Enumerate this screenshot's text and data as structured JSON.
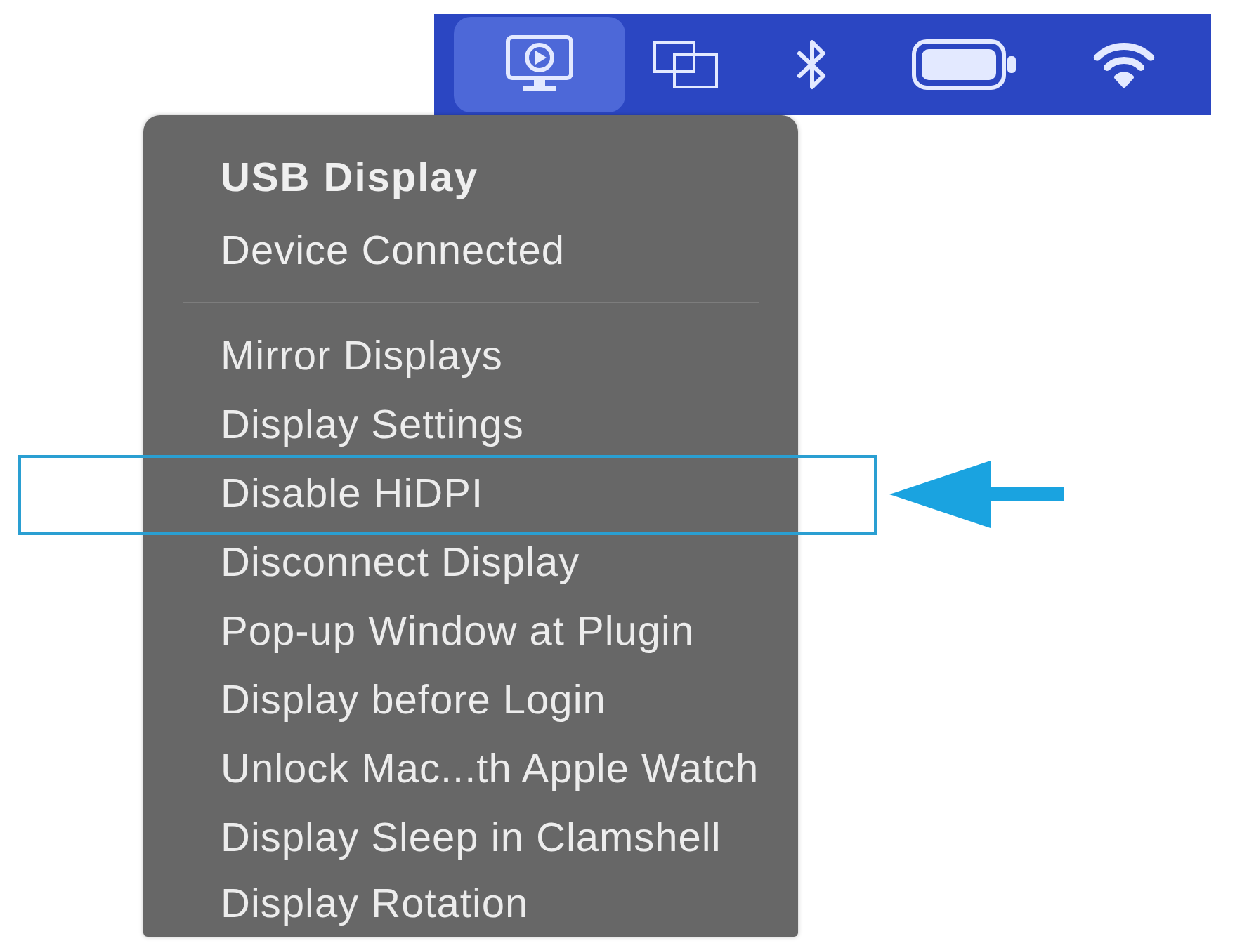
{
  "menu_bar": {
    "items": [
      {
        "kind": "display",
        "selected": true
      },
      {
        "kind": "windows",
        "selected": false
      },
      {
        "kind": "bluetooth",
        "selected": false
      },
      {
        "kind": "battery",
        "selected": false
      },
      {
        "kind": "wifi",
        "selected": false
      }
    ]
  },
  "menu": {
    "title": "USB Display",
    "status": "Device Connected",
    "items": [
      {
        "label": "Mirror Displays",
        "highlighted": false
      },
      {
        "label": "Display Settings",
        "highlighted": false
      },
      {
        "label": "Disable HiDPI",
        "highlighted": true
      },
      {
        "label": "Disconnect Display",
        "highlighted": false
      },
      {
        "label": "Pop-up Window at Plugin",
        "highlighted": false
      },
      {
        "label": "Display before Login",
        "highlighted": false
      },
      {
        "label": "Unlock Mac...th Apple Watch",
        "highlighted": false
      },
      {
        "label": "Display Sleep in Clamshell",
        "highlighted": false
      },
      {
        "label": "Display Rotation",
        "highlighted": false
      }
    ]
  }
}
